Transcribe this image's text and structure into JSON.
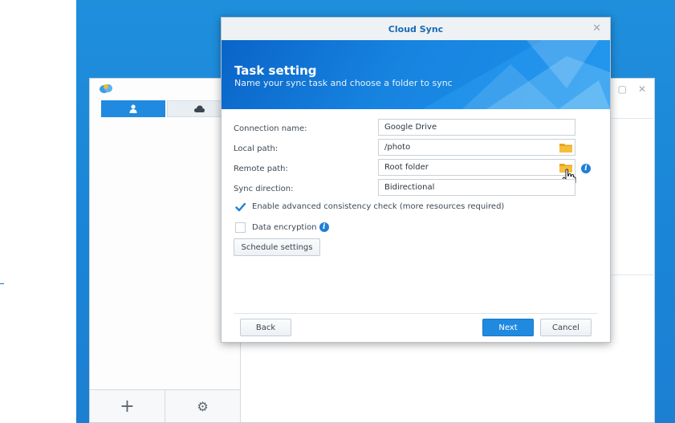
{
  "watermark": "",
  "colors": {
    "accent": "#1f8ae0",
    "title_text": "#1a69b4",
    "folder": "#f2b21f",
    "check": "#1f7fd6"
  },
  "background_window": {
    "tabs": [
      {
        "icon": "user-icon"
      },
      {
        "icon": "cloud-icon"
      }
    ],
    "bottom_buttons": [
      {
        "icon": "plus-icon",
        "glyph": "+"
      },
      {
        "icon": "gear-icon",
        "glyph": "⚙"
      }
    ],
    "window_controls": {
      "maximize": "▢",
      "close": "✕"
    }
  },
  "dialog": {
    "title": "Cloud Sync",
    "close": "✕",
    "heading": "Task setting",
    "subheading": "Name your sync task and choose a folder to sync",
    "fields": [
      {
        "label": "Connection name:",
        "value": "Google Drive"
      },
      {
        "label": "Local path:",
        "value": "/photo"
      },
      {
        "label": "Remote path:",
        "value": "Root folder"
      },
      {
        "label": "Sync direction:",
        "value": "Bidirectional"
      }
    ],
    "consistency_check": {
      "label": "Enable advanced consistency check (more resources required)",
      "checked": true
    },
    "data_encryption": {
      "label": "Data encryption",
      "checked": false
    },
    "info_glyph": "i",
    "schedule_button": "Schedule settings",
    "back_button": "Back",
    "next_button": "Next",
    "cancel_button": "Cancel"
  }
}
